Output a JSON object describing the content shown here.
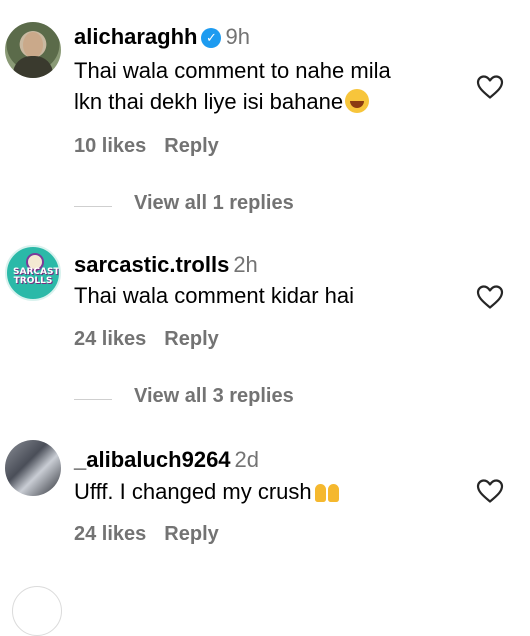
{
  "comments": [
    {
      "username": "alicharaghh",
      "verified": true,
      "time": "9h",
      "text_line1": "Thai wala comment to nahe mila",
      "text_line2": "lkn thai dekh liye isi bahane",
      "emoji": "face-with-tears-of-joy",
      "likes": "10 likes",
      "reply": "Reply",
      "view_replies": "View all 1 replies"
    },
    {
      "username": "sarcastic.trolls",
      "avatar_text": "SARCASTIC TROLLS",
      "time": "2h",
      "text": "Thai wala comment kidar hai",
      "likes": "24 likes",
      "reply": "Reply",
      "view_replies": "View all 3 replies"
    },
    {
      "username": "_alibaluch9264",
      "time": "2d",
      "text": "Ufff. I changed my crush",
      "emoji": "raising-hands",
      "likes": "24 likes",
      "reply": "Reply"
    }
  ],
  "colors": {
    "secondary_text": "#737373",
    "verified": "#1d9bf0",
    "emoji": "#f7c53b"
  }
}
